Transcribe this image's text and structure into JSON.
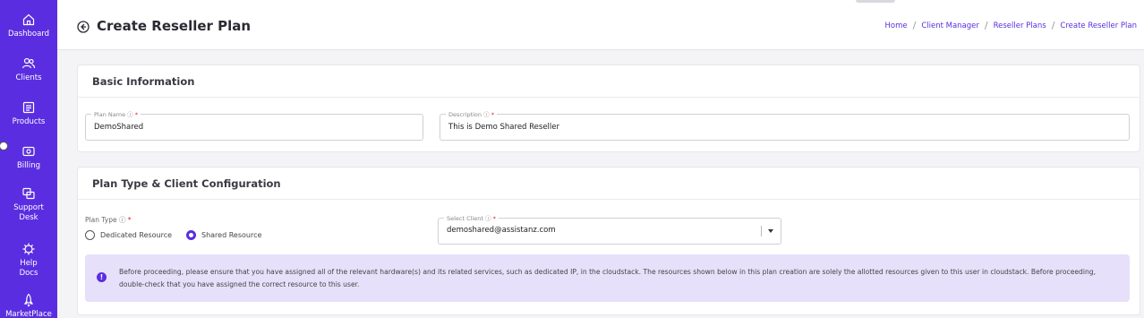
{
  "sidebar": {
    "items": [
      {
        "label": "Dashboard",
        "icon": "home-icon"
      },
      {
        "label": "Clients",
        "icon": "users-icon"
      },
      {
        "label": "Products",
        "icon": "products-icon"
      },
      {
        "label": "Billing",
        "icon": "billing-icon"
      },
      {
        "label": "Support Desk",
        "icon": "support-icon"
      },
      {
        "label": "Help Docs",
        "icon": "help-icon"
      },
      {
        "label": "MarketPlace",
        "icon": "rocket-icon"
      }
    ]
  },
  "header": {
    "title": "Create Reseller Plan",
    "breadcrumb": [
      "Home",
      "Client Manager",
      "Reseller Plans",
      "Create Reseller Plan"
    ]
  },
  "basic_info": {
    "title": "Basic Information",
    "plan_name": {
      "label": "Plan Name",
      "value": "DemoShared"
    },
    "description": {
      "label": "Description",
      "value": "This is Demo Shared Reseller"
    }
  },
  "plan_config": {
    "title": "Plan Type & Client Configuration",
    "plan_type_label": "Plan Type",
    "options": [
      {
        "label": "Dedicated Resource",
        "selected": false
      },
      {
        "label": "Shared Resource",
        "selected": true
      }
    ],
    "select_client": {
      "label": "Select Client",
      "value": "demoshared@assistanz.com"
    },
    "alert": "Before proceeding, please ensure that you have assigned all of the relevant hardware(s) and its related services, such as dedicated IP, in the cloudstack. The resources shown below in this plan creation are solely the allotted resources given to this user in cloudstack. Before proceeding, double-check that you have assigned the correct resource to this user."
  },
  "colors": {
    "accent": "#5a2ee0",
    "alert_bg": "#e6e0fb",
    "required": "#e02020"
  }
}
